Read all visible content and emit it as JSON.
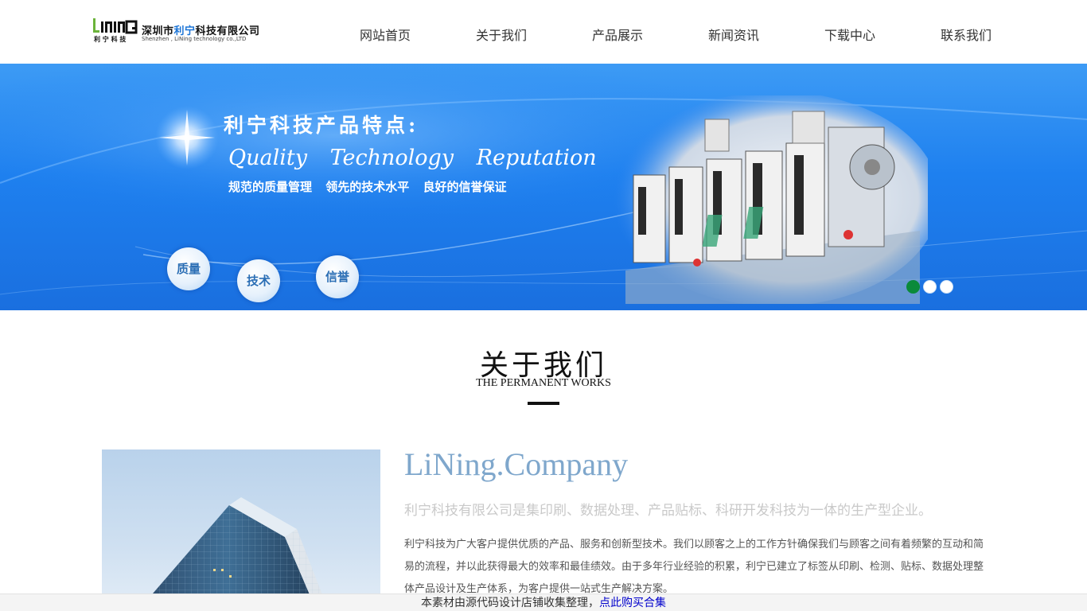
{
  "header": {
    "logo": {
      "mark_text": "LiNiNG",
      "mark_sub": "利 宁 科 技",
      "name_part1": "深圳市",
      "name_highlight": "利宁",
      "name_part2": "科技有限公司",
      "name_en": "Shenzhen , LiNing technology co.,LTD"
    },
    "nav": [
      {
        "label": "网站首页"
      },
      {
        "label": "关于我们"
      },
      {
        "label": "产品展示"
      },
      {
        "label": "新闻资讯"
      },
      {
        "label": "下载中心"
      },
      {
        "label": "联系我们"
      }
    ]
  },
  "banner": {
    "title": "利宁科技产品特点:",
    "slogan": "Quality Technology Reputation",
    "subtitle": "规范的质量管理 领先的技术水平 良好的信誉保证",
    "badges": [
      "质量",
      "技术",
      "信誉"
    ],
    "slides": 3,
    "active_slide": 1,
    "colors": {
      "primary": "#1e80ef",
      "active_dot": "#0b8a3a"
    }
  },
  "about": {
    "title": "关于我们",
    "subtitle": "THE PERMANENT WORKS",
    "company_name": "LiNing.Company",
    "slogan": "利宁科技有限公司是集印刷、数据处理、产品贴标、科研开发科技为一体的生产型企业。",
    "description": "利宁科技为广大客户提供优质的产品、服务和创新型技术。我们以顾客之上的工作方针确保我们与顾客之间有着频繁的互动和简易的流程，并以此获得最大的效率和最佳绩效。由于多年行业经验的积累，利宁已建立了标签从印刷、检测、贴标、数据处理整体产品设计及生产体系，为客户提供一站式生产解决方案。"
  },
  "notice": {
    "text": "本素材由源代码设计店铺收集整理，",
    "link": "点此购买合集"
  }
}
